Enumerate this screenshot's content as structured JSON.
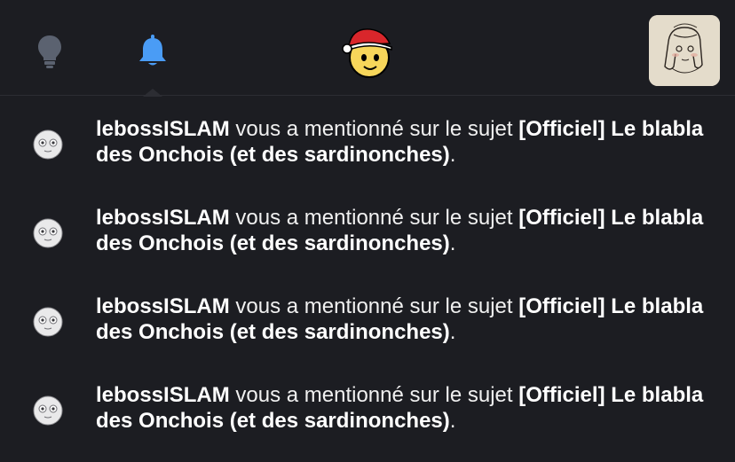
{
  "nav": {
    "icons": [
      "lightbulb-icon",
      "bell-icon",
      "santa-mascot-icon"
    ],
    "active_color": "#4a9cf5",
    "inactive_color": "#5b6270"
  },
  "notifications": [
    {
      "user": "lebossISLAM",
      "action": " vous a mentionné sur le sujet ",
      "topic": "[Officiel] Le blabla des Onchois (et des sardinonches)",
      "end": "."
    },
    {
      "user": "lebossISLAM",
      "action": " vous a mentionné sur le sujet ",
      "topic": "[Officiel] Le blabla des Onchois (et des sardinonches)",
      "end": "."
    },
    {
      "user": "lebossISLAM",
      "action": " vous a mentionné sur le sujet ",
      "topic": "[Officiel] Le blabla des Onchois (et des sardinonches)",
      "end": "."
    },
    {
      "user": "lebossISLAM",
      "action": " vous a mentionné sur le sujet ",
      "topic": "[Officiel] Le blabla des Onchois (et des sardinonches)",
      "end": "."
    }
  ]
}
